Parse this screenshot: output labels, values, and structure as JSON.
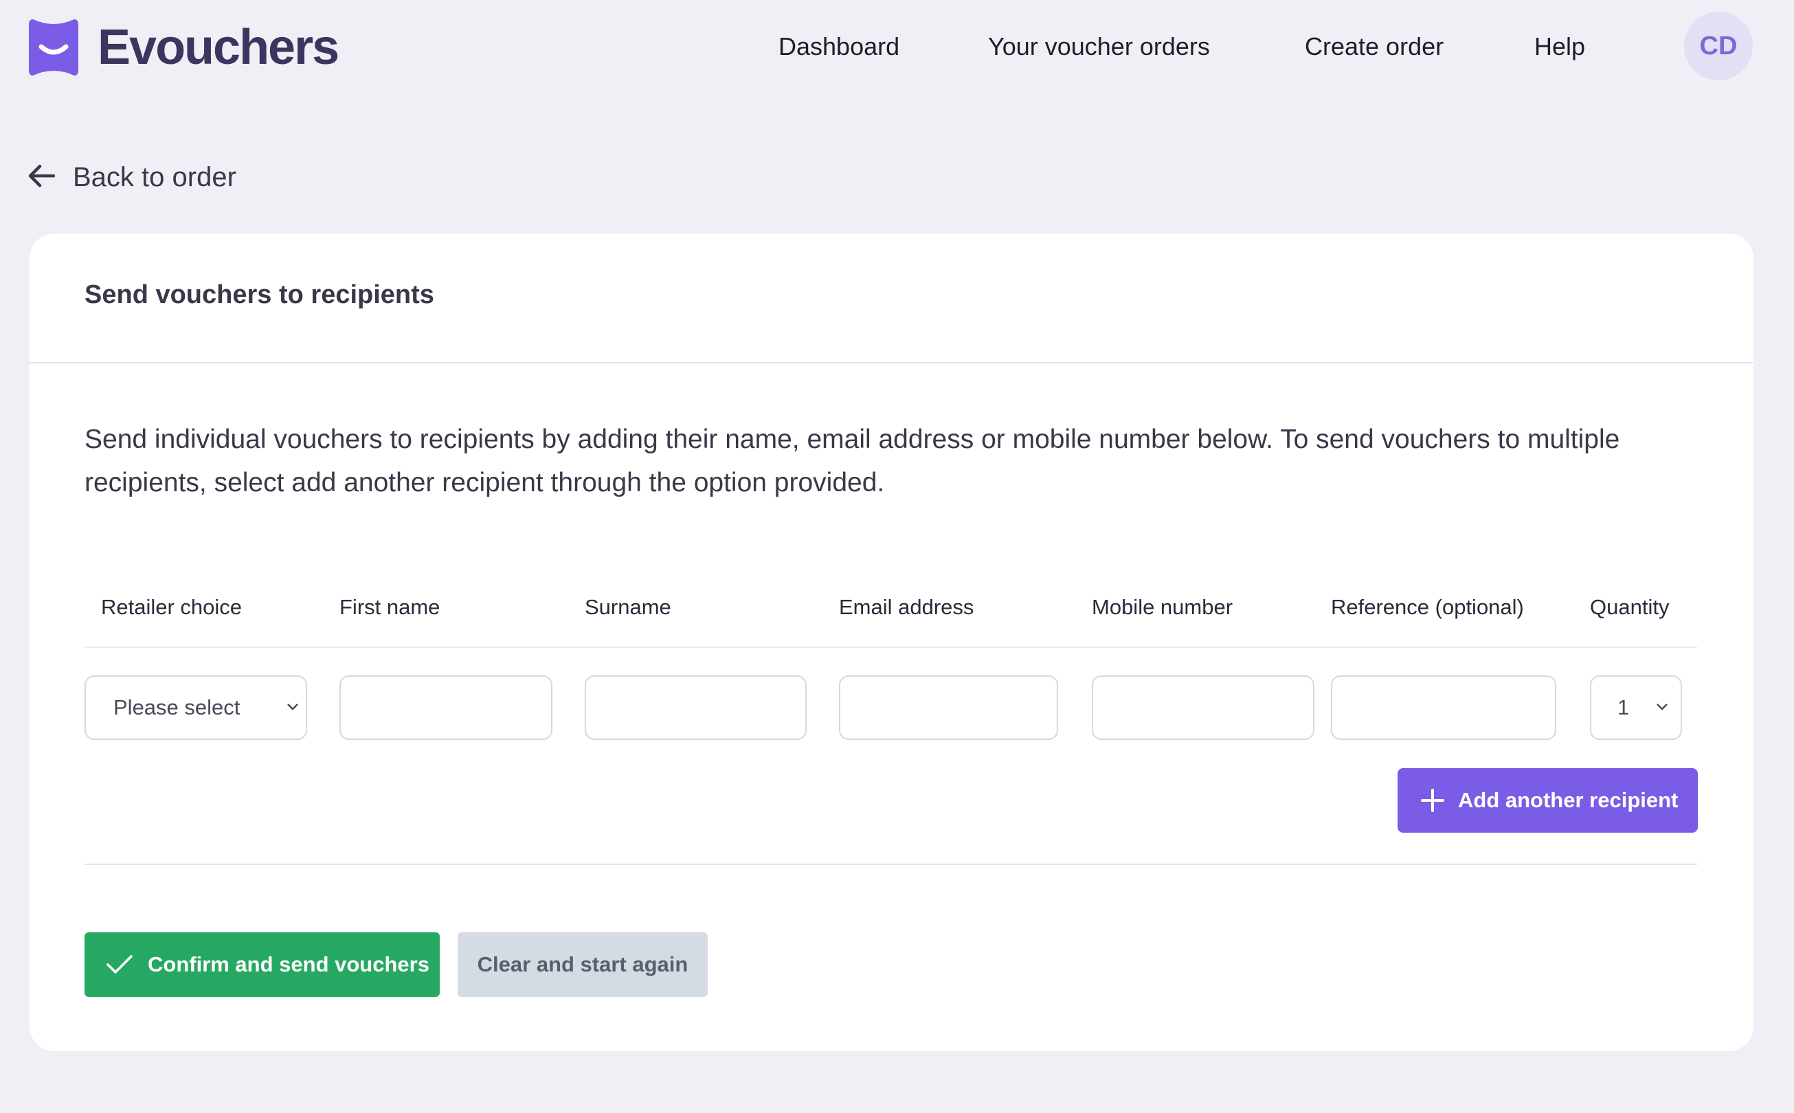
{
  "brand": {
    "name": "Evouchers",
    "logo_icon": "evouchers-logo-icon",
    "logo_color": "#7b5ce6"
  },
  "nav": {
    "items": [
      {
        "label": "Dashboard"
      },
      {
        "label": "Your voucher orders"
      },
      {
        "label": "Create order"
      },
      {
        "label": "Help"
      }
    ],
    "avatar_initials": "CD"
  },
  "back": {
    "label": "Back to order",
    "icon": "arrow-left-icon"
  },
  "card": {
    "title": "Send vouchers to recipients",
    "intro": "Send individual vouchers to recipients by adding their name, email address or mobile number below. To send vouchers to multiple recipients, select add another recipient through the option provided."
  },
  "table": {
    "columns": [
      "Retailer choice",
      "First name",
      "Surname",
      "Email address",
      "Mobile number",
      "Reference (optional)",
      "Quantity"
    ],
    "rows": [
      {
        "retailer_choice": "Please select",
        "first_name": "",
        "surname": "",
        "email_address": "",
        "mobile_number": "",
        "reference": "",
        "quantity": "1"
      }
    ]
  },
  "actions": {
    "add_recipient": "Add another recipient",
    "confirm": "Confirm and send vouchers",
    "clear": "Clear and start again"
  },
  "colors": {
    "page_bg": "#f0eff5",
    "accent_purple": "#7b5ce6",
    "confirm_green": "#27a862",
    "clear_grey": "#d5dbe3"
  }
}
